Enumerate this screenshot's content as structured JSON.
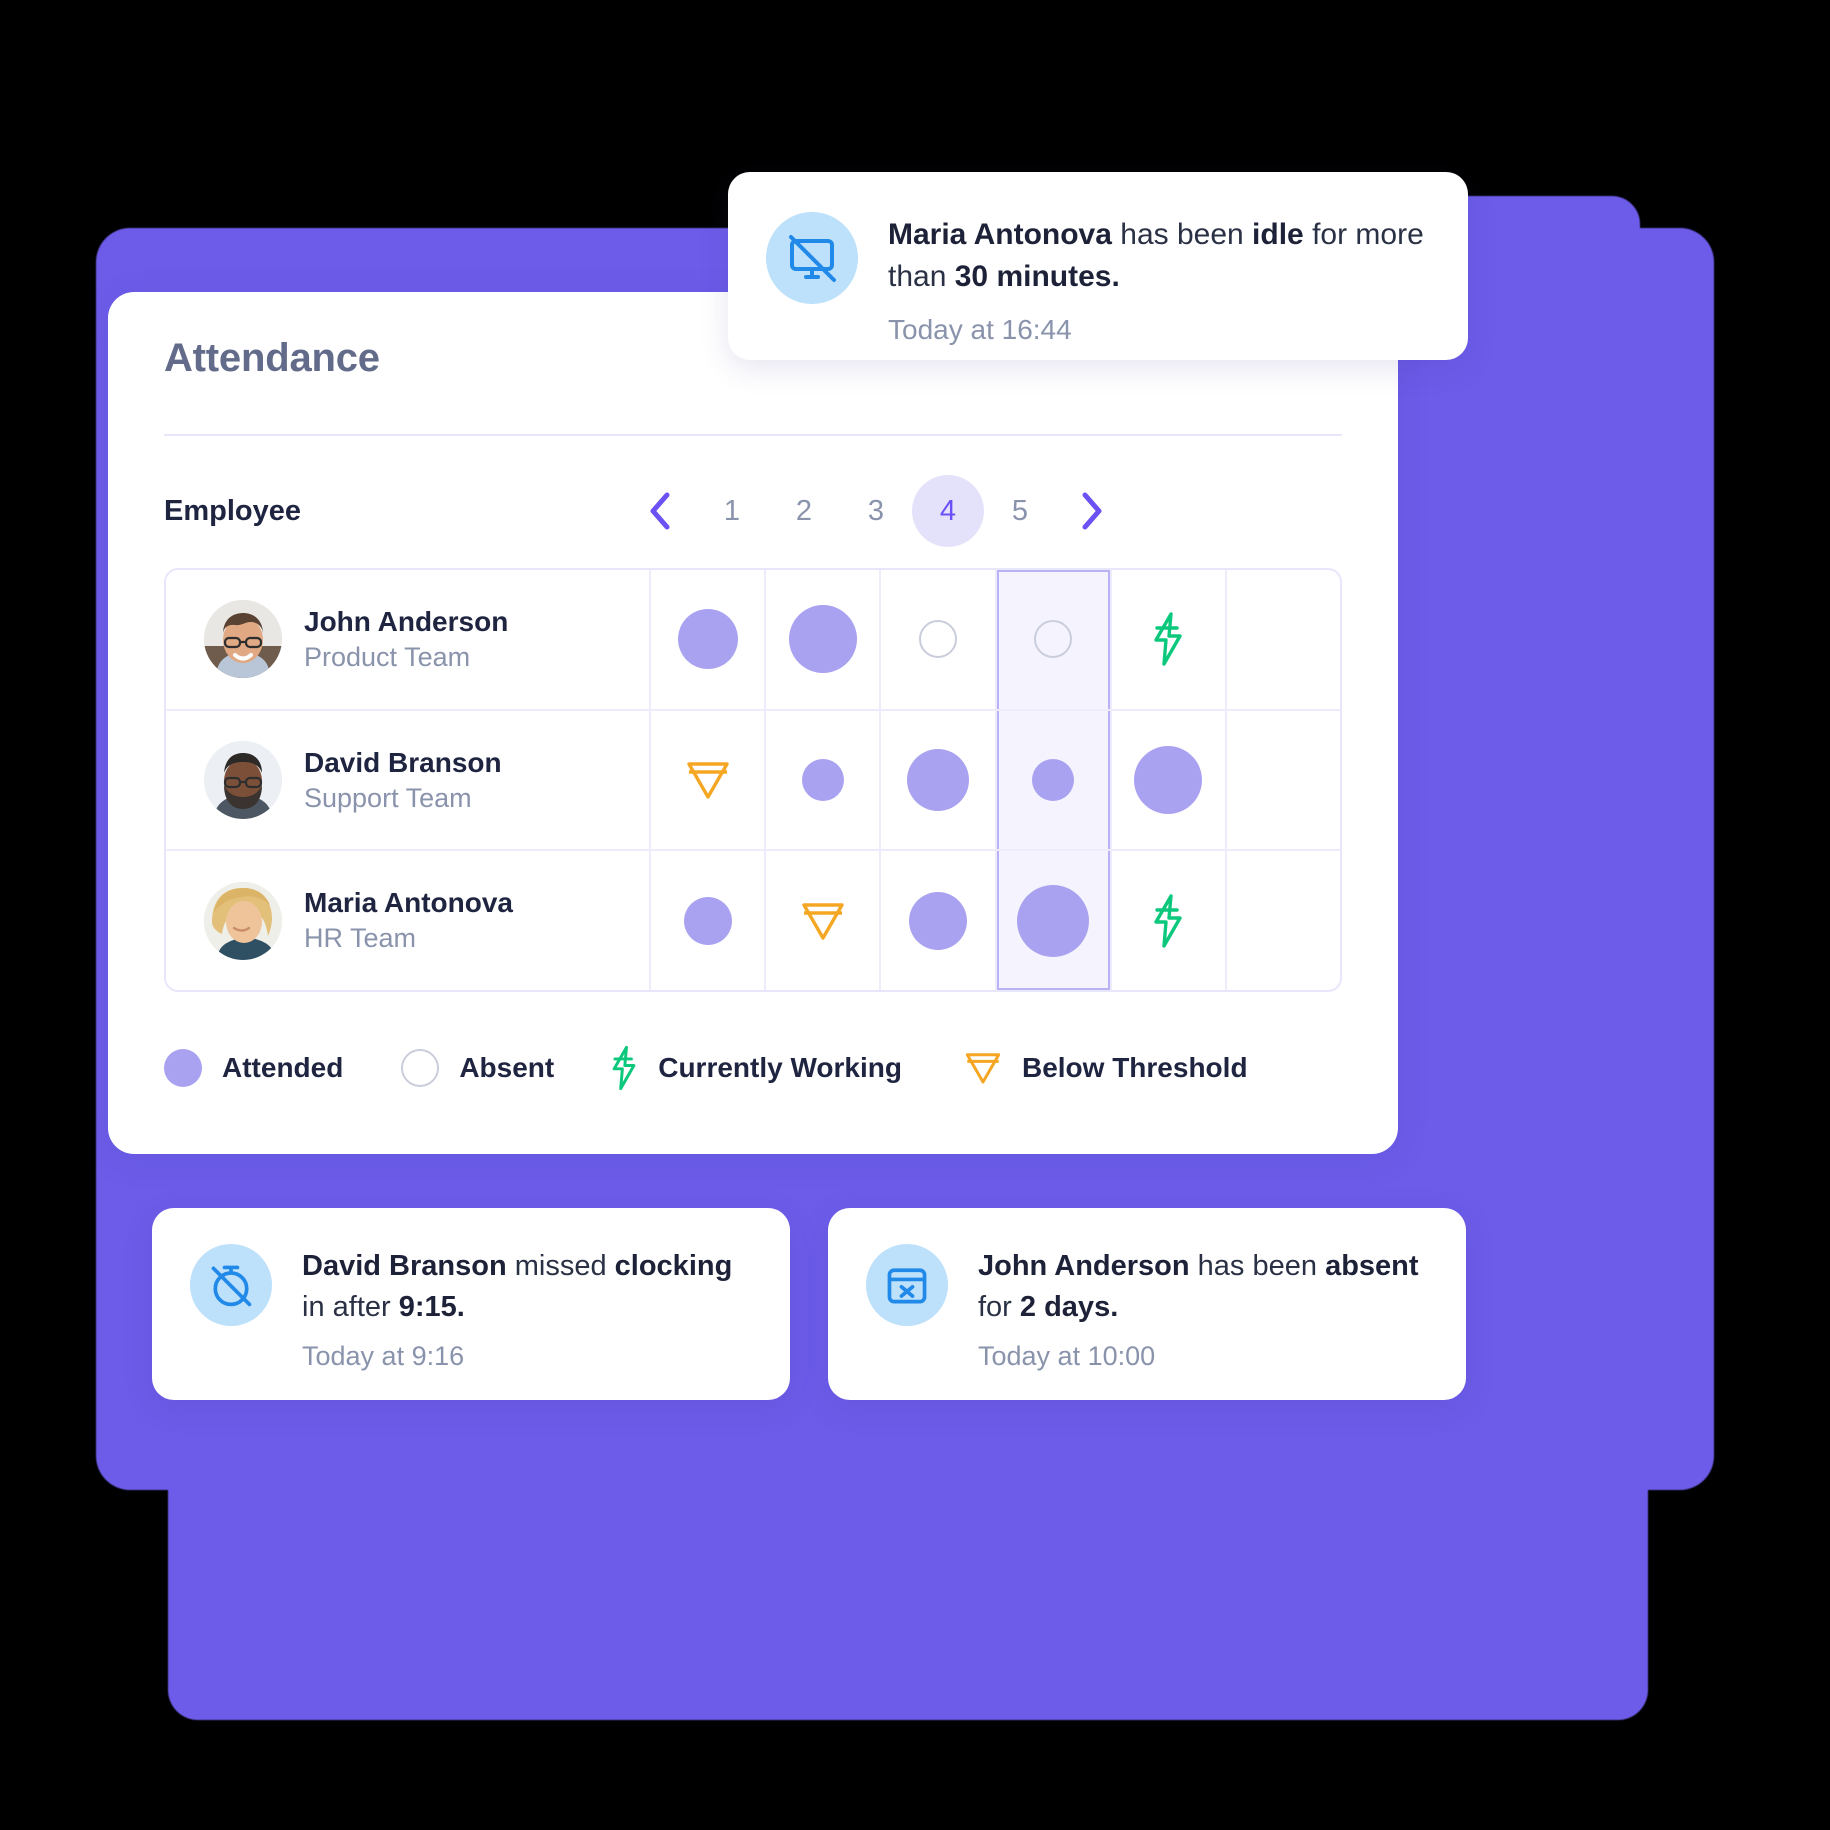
{
  "colors": {
    "accent_purple": "#6c5ce9",
    "dot_purple": "#a9a2f0",
    "active_pill_bg": "#e4e2fb",
    "active_pill_text": "#6c4ff6",
    "green": "#0bc87d",
    "amber": "#f5a623",
    "icon_bg_blue": "#bde0fb",
    "icon_blue": "#2189e8",
    "muted_text": "#8a93ac",
    "title_text": "#626b8a"
  },
  "card": {
    "title": "Attendance",
    "employee_column_header": "Employee"
  },
  "pagination": {
    "prev_icon": "chevron-left-icon",
    "next_icon": "chevron-right-icon",
    "pages": [
      "1",
      "2",
      "3",
      "4",
      "5"
    ],
    "active_page": "4"
  },
  "rows": [
    {
      "name": "John Anderson",
      "team": "Product Team",
      "avatar": "photo-man-glasses",
      "cells": [
        "attended",
        "attended",
        "absent",
        "absent",
        "working",
        "empty"
      ],
      "sizes": [
        60,
        68,
        38,
        38,
        0,
        0
      ]
    },
    {
      "name": "David Branson",
      "team": "Support Team",
      "avatar": "photo-man-beard",
      "cells": [
        "below",
        "attended",
        "attended",
        "attended",
        "attended",
        "empty"
      ],
      "sizes": [
        0,
        42,
        62,
        42,
        68,
        0
      ]
    },
    {
      "name": "Maria Antonova",
      "team": "HR Team",
      "avatar": "photo-woman-blonde",
      "cells": [
        "attended",
        "below",
        "attended",
        "attended",
        "working",
        "empty"
      ],
      "sizes": [
        48,
        0,
        58,
        72,
        0,
        0
      ]
    }
  ],
  "legend": [
    {
      "icon": "attended-dot-icon",
      "label": "Attended"
    },
    {
      "icon": "absent-ring-icon",
      "label": "Absent"
    },
    {
      "icon": "currently-working-bolt-icon",
      "label": "Currently Working"
    },
    {
      "icon": "below-threshold-triangle-icon",
      "label": "Below Threshold"
    }
  ],
  "notifications": {
    "idle": {
      "icon": "monitor-off-icon",
      "parts": [
        {
          "text": "Maria Antonova",
          "bold": true
        },
        {
          "text": " has been ",
          "bold": false
        },
        {
          "text": "idle",
          "bold": true
        },
        {
          "text": " for more than ",
          "bold": false
        },
        {
          "text": "30 minutes.",
          "bold": true
        }
      ],
      "message": "Maria Antonova has been idle for more than 30 minutes.",
      "time": "Today at 16:44"
    },
    "missed_clockin": {
      "icon": "timer-off-icon",
      "parts": [
        {
          "text": "David Branson",
          "bold": true
        },
        {
          "text": " missed ",
          "bold": false
        },
        {
          "text": "clocking",
          "bold": true
        },
        {
          "text": " in after ",
          "bold": false
        },
        {
          "text": "9:15.",
          "bold": true
        }
      ],
      "message": "David Branson missed clocking in after 9:15.",
      "time": "Today at 9:16"
    },
    "absent": {
      "icon": "calendar-x-icon",
      "parts": [
        {
          "text": "John Anderson",
          "bold": true
        },
        {
          "text": " has been ",
          "bold": false
        },
        {
          "text": "absent",
          "bold": true
        },
        {
          "text": " for ",
          "bold": false
        },
        {
          "text": "2 days.",
          "bold": true
        }
      ],
      "message": "John Anderson has been absent for 2 days.",
      "time": "Today at 10:00"
    }
  }
}
